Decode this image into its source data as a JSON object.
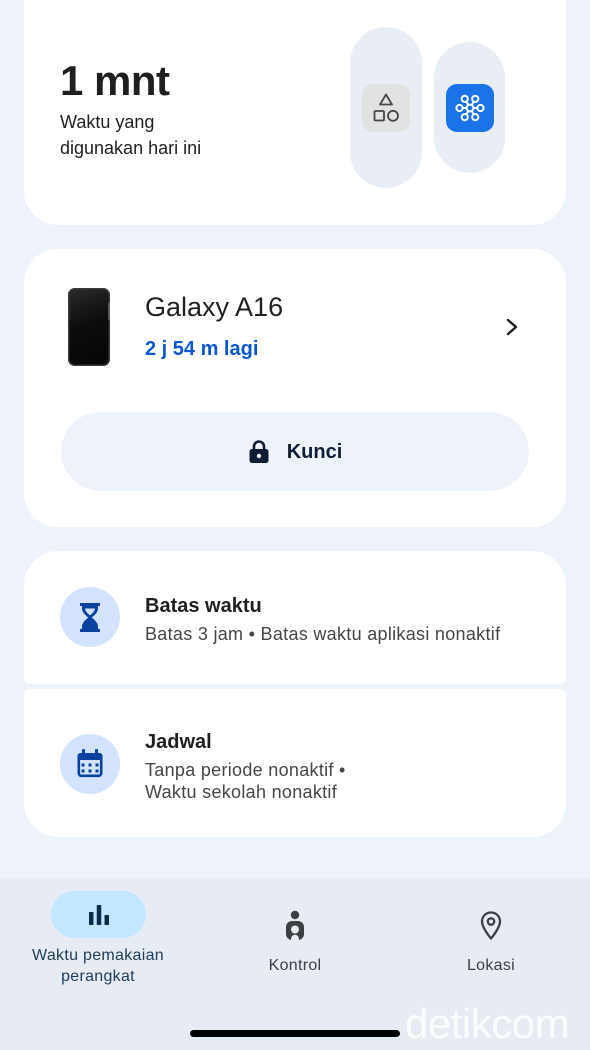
{
  "usage_summary": {
    "value": "1 mnt",
    "caption_line1": "Waktu yang",
    "caption_line2": "digunakan hari ini",
    "apps": [
      {
        "icon": "shapes-icon",
        "icon_bg": "#e1e3e2"
      },
      {
        "icon": "network-icon",
        "icon_bg": "#1a73e8"
      }
    ]
  },
  "device": {
    "image": "phone-image",
    "name": "Galaxy A16",
    "time_left": "2 j 54 m lagi",
    "chevron_icon": "chevron-right-icon",
    "lock_icon": "lock-icon",
    "lock_label": "Kunci"
  },
  "settings": [
    {
      "icon": "hourglass-icon",
      "title": "Batas waktu",
      "subtitle_lines": [
        "Batas 3 jam • Batas waktu aplikasi nonaktif"
      ]
    },
    {
      "icon": "calendar-icon",
      "title": "Jadwal",
      "subtitle_lines": [
        "Tanpa periode nonaktif •",
        "Waktu sekolah nonaktif"
      ]
    }
  ],
  "bottom_nav": {
    "items": [
      {
        "icon": "bar-chart-icon",
        "label_lines": [
          "Waktu pemakaian",
          "perangkat"
        ],
        "active": true
      },
      {
        "icon": "child-person-icon",
        "label_lines": [
          "Kontrol"
        ],
        "active": false
      },
      {
        "icon": "location-pin-icon",
        "label_lines": [
          "Lokasi"
        ],
        "active": false
      }
    ]
  },
  "watermark": "detikcom",
  "colors": {
    "page_background": "#eef2f9",
    "card_background": "#ffffff",
    "accent_blue": "#0b57d0",
    "app_blue": "#1a73e8",
    "icon_circle": "#d3e3fd",
    "icon_navy": "#0842a0",
    "nav_background": "#e7ecf4",
    "nav_active_pill": "#c2e7ff",
    "text_primary": "#1f1f1f",
    "text_secondary": "#444746"
  }
}
